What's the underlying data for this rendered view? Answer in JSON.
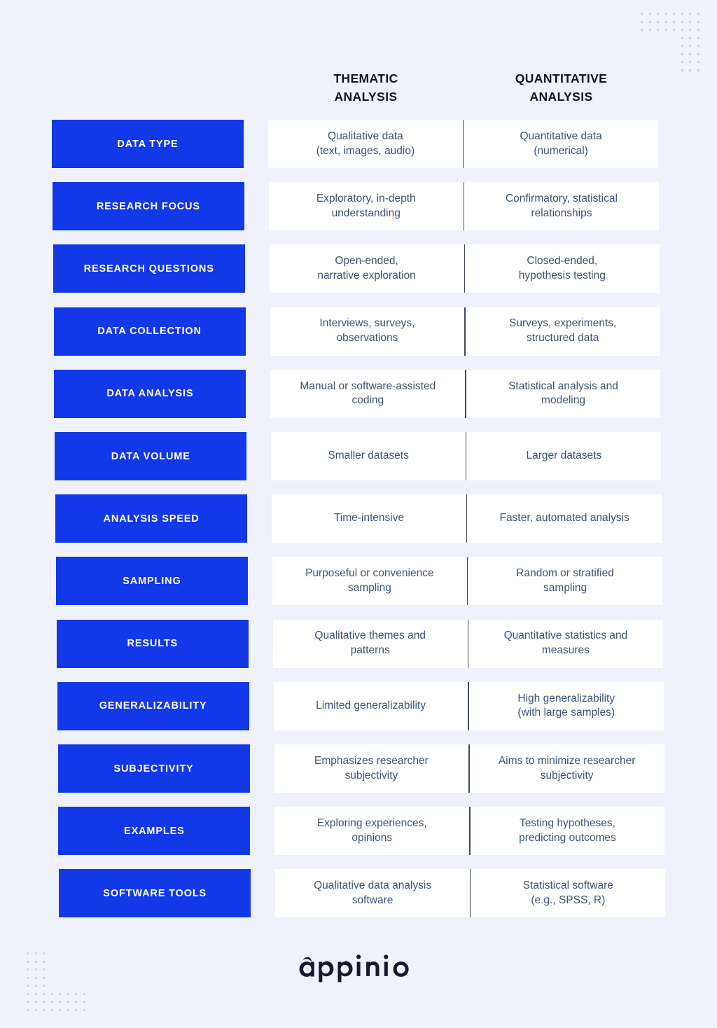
{
  "theme": {
    "background": "#eff2fb",
    "label_blue": "#1338e8",
    "label_text": "#ffffff",
    "card_background": "#ffffff",
    "cell_text": "#3f5372",
    "header_text": "#111325",
    "divider": "#414a60",
    "dot_color": "#c6cddf"
  },
  "columns": [
    {
      "title": "THEMATIC\nANALYSIS"
    },
    {
      "title": "QUANTITATIVE\nANALYSIS"
    }
  ],
  "rows": [
    {
      "label": "DATA TYPE",
      "thematic": "Qualitative data\n(text, images, audio)",
      "quantitative": "Quantitative data\n(numerical)"
    },
    {
      "label": "RESEARCH FOCUS",
      "thematic": "Exploratory, in-depth\nunderstanding",
      "quantitative": "Confirmatory, statistical\nrelationships"
    },
    {
      "label": "RESEARCH QUESTIONS",
      "thematic": "Open-ended,\nnarrative exploration",
      "quantitative": "Closed-ended,\nhypothesis testing"
    },
    {
      "label": "DATA COLLECTION",
      "thematic": "Interviews, surveys,\nobservations",
      "quantitative": "Surveys, experiments,\nstructured data"
    },
    {
      "label": "DATA ANALYSIS",
      "thematic": "Manual or software-assisted\ncoding",
      "quantitative": "Statistical analysis and\nmodeling"
    },
    {
      "label": "DATA VOLUME",
      "thematic": "Smaller datasets",
      "quantitative": "Larger datasets"
    },
    {
      "label": "ANALYSIS SPEED",
      "thematic": "Time-intensive",
      "quantitative": "Faster, automated analysis"
    },
    {
      "label": "SAMPLING",
      "thematic": "Purposeful or convenience\nsampling",
      "quantitative": "Random or stratified\nsampling"
    },
    {
      "label": "RESULTS",
      "thematic": "Qualitative themes and\npatterns",
      "quantitative": "Quantitative statistics and\nmeasures"
    },
    {
      "label": "GENERALIZABILITY",
      "thematic": "Limited generalizability",
      "quantitative": "High generalizability\n(with large samples)"
    },
    {
      "label": "SUBJECTIVITY",
      "thematic": "Emphasizes researcher\nsubjectivity",
      "quantitative": "Aims to minimize researcher\nsubjectivity"
    },
    {
      "label": "EXAMPLES",
      "thematic": "Exploring experiences,\nopinions",
      "quantitative": "Testing hypotheses,\npredicting outcomes"
    },
    {
      "label": "SOFTWARE TOOLS",
      "thematic": "Qualitative data analysis\nsoftware",
      "quantitative": "Statistical software\n(e.g., SPSS, R)"
    }
  ],
  "logo": {
    "name": "appinio",
    "wordmark": "appinio"
  }
}
